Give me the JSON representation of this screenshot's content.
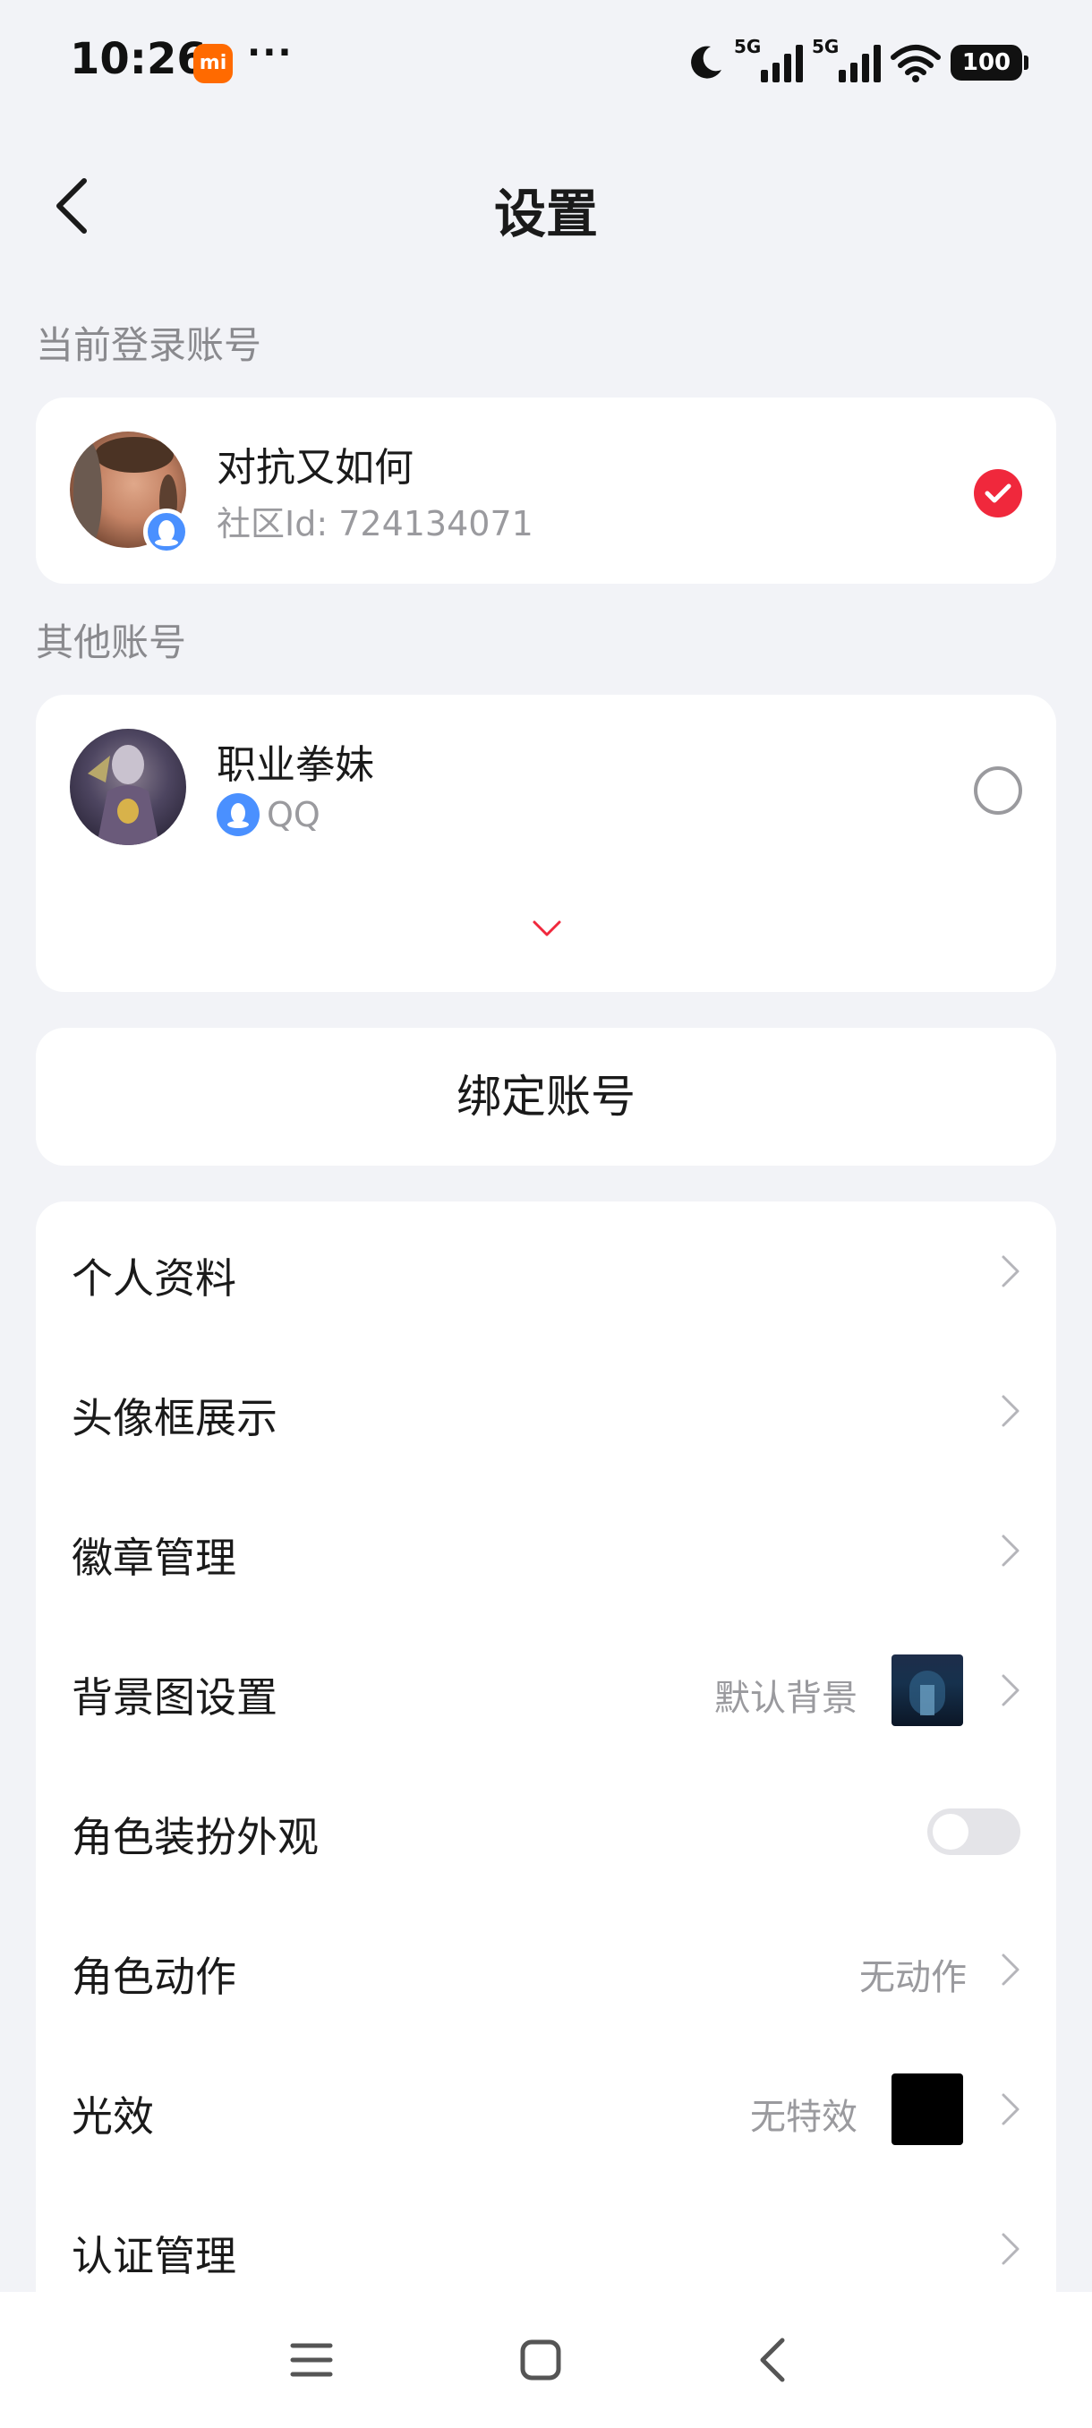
{
  "status_bar": {
    "time": "10:26",
    "mi_label": "mi",
    "more": "···",
    "signal1_tag": "5G",
    "signal2_tag": "5G",
    "battery": "100"
  },
  "header": {
    "title": "设置"
  },
  "current_account": {
    "section_label": "当前登录账号",
    "name": "对抗又如何",
    "community_id": "社区Id: 724134071",
    "selected": true
  },
  "other_accounts": {
    "section_label": "其他账号",
    "items": [
      {
        "name": "职业拳妹",
        "platform": "QQ",
        "selected": false
      }
    ]
  },
  "bind_button": {
    "label": "绑定账号"
  },
  "settings": [
    {
      "label": "个人资料"
    },
    {
      "label": "头像框展示"
    },
    {
      "label": "徽章管理"
    },
    {
      "label": "背景图设置",
      "value": "默认背景"
    },
    {
      "label": "角色装扮外观",
      "toggle_on": false
    },
    {
      "label": "角色动作",
      "value": "无动作"
    },
    {
      "label": "光效",
      "value": "无特效"
    },
    {
      "label": "认证管理"
    }
  ],
  "colors": {
    "accent_red": "#f0283c",
    "qq_blue": "#4a90ff",
    "page_bg": "#f2f3f7",
    "card_bg": "#ffffff",
    "secondary_text": "#9a9a9e"
  }
}
